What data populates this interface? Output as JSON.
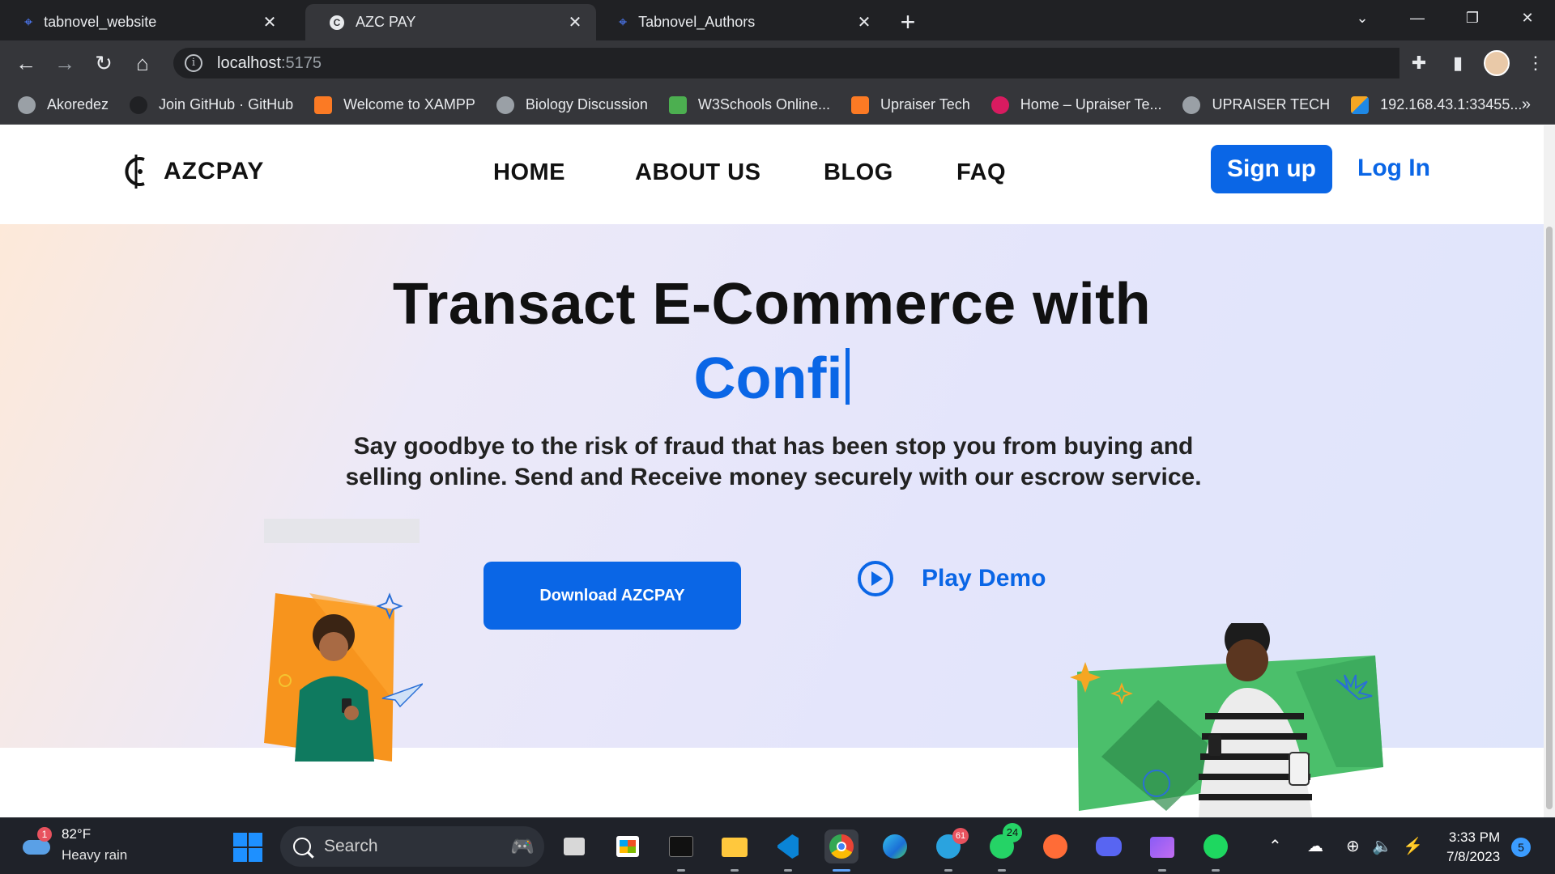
{
  "browser": {
    "tabs": [
      {
        "title": "tabnovel_website",
        "active": false
      },
      {
        "title": "AZC PAY",
        "active": true
      },
      {
        "title": "Tabnovel_Authors",
        "active": false
      }
    ],
    "url_host": "localhost",
    "url_port": ":5175",
    "bookmarks": [
      {
        "label": "Akoredez",
        "color": "#9aa0a6"
      },
      {
        "label": "Join GitHub · GitHub",
        "color": "#202124"
      },
      {
        "label": "Welcome to XAMPP",
        "color": "#fb7a24"
      },
      {
        "label": "Biology Discussion",
        "color": "#9aa0a6"
      },
      {
        "label": "W3Schools Online...",
        "color": "#4caf50"
      },
      {
        "label": "Upraiser Tech",
        "color": "#fb7a24"
      },
      {
        "label": "Home – Upraiser Te...",
        "color": "#d81b60"
      },
      {
        "label": "UPRAISER TECH",
        "color": "#9aa0a6"
      },
      {
        "label": "192.168.43.1:33455...",
        "color": "#1e88e5"
      }
    ],
    "more": "»"
  },
  "site": {
    "brand": "AZCPAY",
    "nav": [
      "HOME",
      "ABOUT US",
      "BLOG",
      "FAQ"
    ],
    "signup": "Sign up",
    "login": "Log In",
    "hero_title": "Transact E-Commerce with",
    "hero_typed": "Confi",
    "hero_sub": "Say goodbye to the risk of fraud that has been stop you from buying and selling online. Send and Receive money securely with our escrow service.",
    "download": "Download AZCPAY",
    "play": "Play Demo",
    "accent": "#0a66e6"
  },
  "taskbar": {
    "weather_temp": "82°F",
    "weather_cond": "Heavy rain",
    "weather_badge": "1",
    "search": "Search",
    "telegram_badge": "61",
    "whatsapp_badge": "24",
    "time": "3:33 PM",
    "date": "7/8/2023",
    "notifications": "5"
  }
}
